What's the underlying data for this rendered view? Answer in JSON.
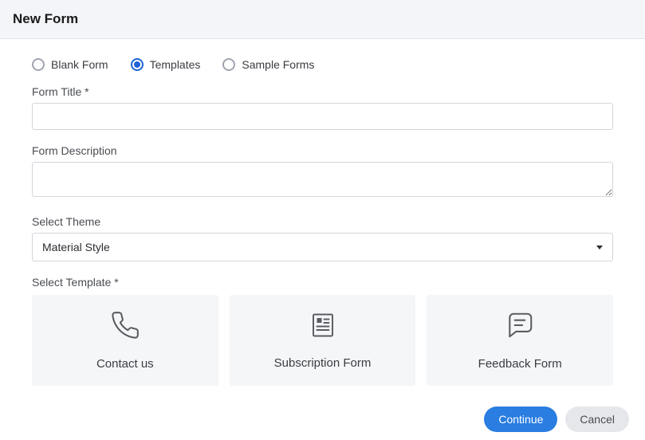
{
  "header": {
    "title": "New Form"
  },
  "form_type": {
    "options": [
      {
        "label": "Blank Form",
        "selected": false
      },
      {
        "label": "Templates",
        "selected": true
      },
      {
        "label": "Sample Forms",
        "selected": false
      }
    ]
  },
  "fields": {
    "title_label": "Form Title",
    "title_required": "*",
    "title_value": "",
    "desc_label": "Form Description",
    "desc_value": "",
    "theme_label": "Select Theme",
    "theme_value": "Material Style",
    "template_label": "Select Template",
    "template_required": "*"
  },
  "templates": [
    {
      "name": "Contact us",
      "icon": "phone"
    },
    {
      "name": "Subscription Form",
      "icon": "document"
    },
    {
      "name": "Feedback Form",
      "icon": "chat"
    }
  ],
  "actions": {
    "continue": "Continue",
    "cancel": "Cancel"
  }
}
